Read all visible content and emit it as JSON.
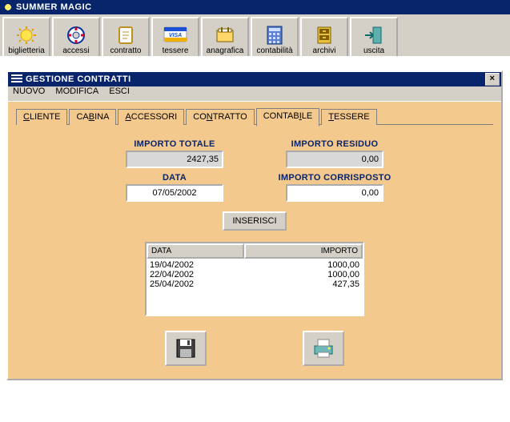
{
  "app_title": "SUMMER MAGIC",
  "toolbar": [
    {
      "name": "biglietteria",
      "label": "biglietteria"
    },
    {
      "name": "accessi",
      "label": "accessi"
    },
    {
      "name": "contratto",
      "label": "contratto"
    },
    {
      "name": "tessere",
      "label": "tessere"
    },
    {
      "name": "anagrafica",
      "label": "anagrafica"
    },
    {
      "name": "contabilita",
      "label": "contabilità"
    },
    {
      "name": "archivi",
      "label": "archivi"
    },
    {
      "name": "uscita",
      "label": "uscita"
    }
  ],
  "child": {
    "title": "GESTIONE CONTRATTI",
    "menu": [
      "NUOVO",
      "MODIFICA",
      "ESCI"
    ],
    "tabs": [
      {
        "label": "CLIENTE",
        "underline": 0
      },
      {
        "label": "CABINA",
        "underline": 2
      },
      {
        "label": "ACCESSORI",
        "underline": 0
      },
      {
        "label": "CONTRATTO",
        "underline": 2
      },
      {
        "label": "CONTABILE",
        "underline": 5,
        "active": true
      },
      {
        "label": "TESSERE",
        "underline": 0
      }
    ],
    "fields": {
      "importo_totale": {
        "label": "IMPORTO TOTALE",
        "value": "2427,35"
      },
      "importo_residuo": {
        "label": "IMPORTO RESIDUO",
        "value": "0,00"
      },
      "data": {
        "label": "DATA",
        "value": "07/05/2002"
      },
      "importo_corrisposto": {
        "label": "IMPORTO CORRISPOSTO",
        "value": "0,00"
      }
    },
    "insert_btn": "INSERISCI",
    "table": {
      "headers": [
        "DATA",
        "IMPORTO"
      ],
      "rows": [
        {
          "data": "19/04/2002",
          "importo": "1000,00"
        },
        {
          "data": "22/04/2002",
          "importo": "1000,00"
        },
        {
          "data": "25/04/2002",
          "importo": "427,35"
        }
      ]
    }
  }
}
